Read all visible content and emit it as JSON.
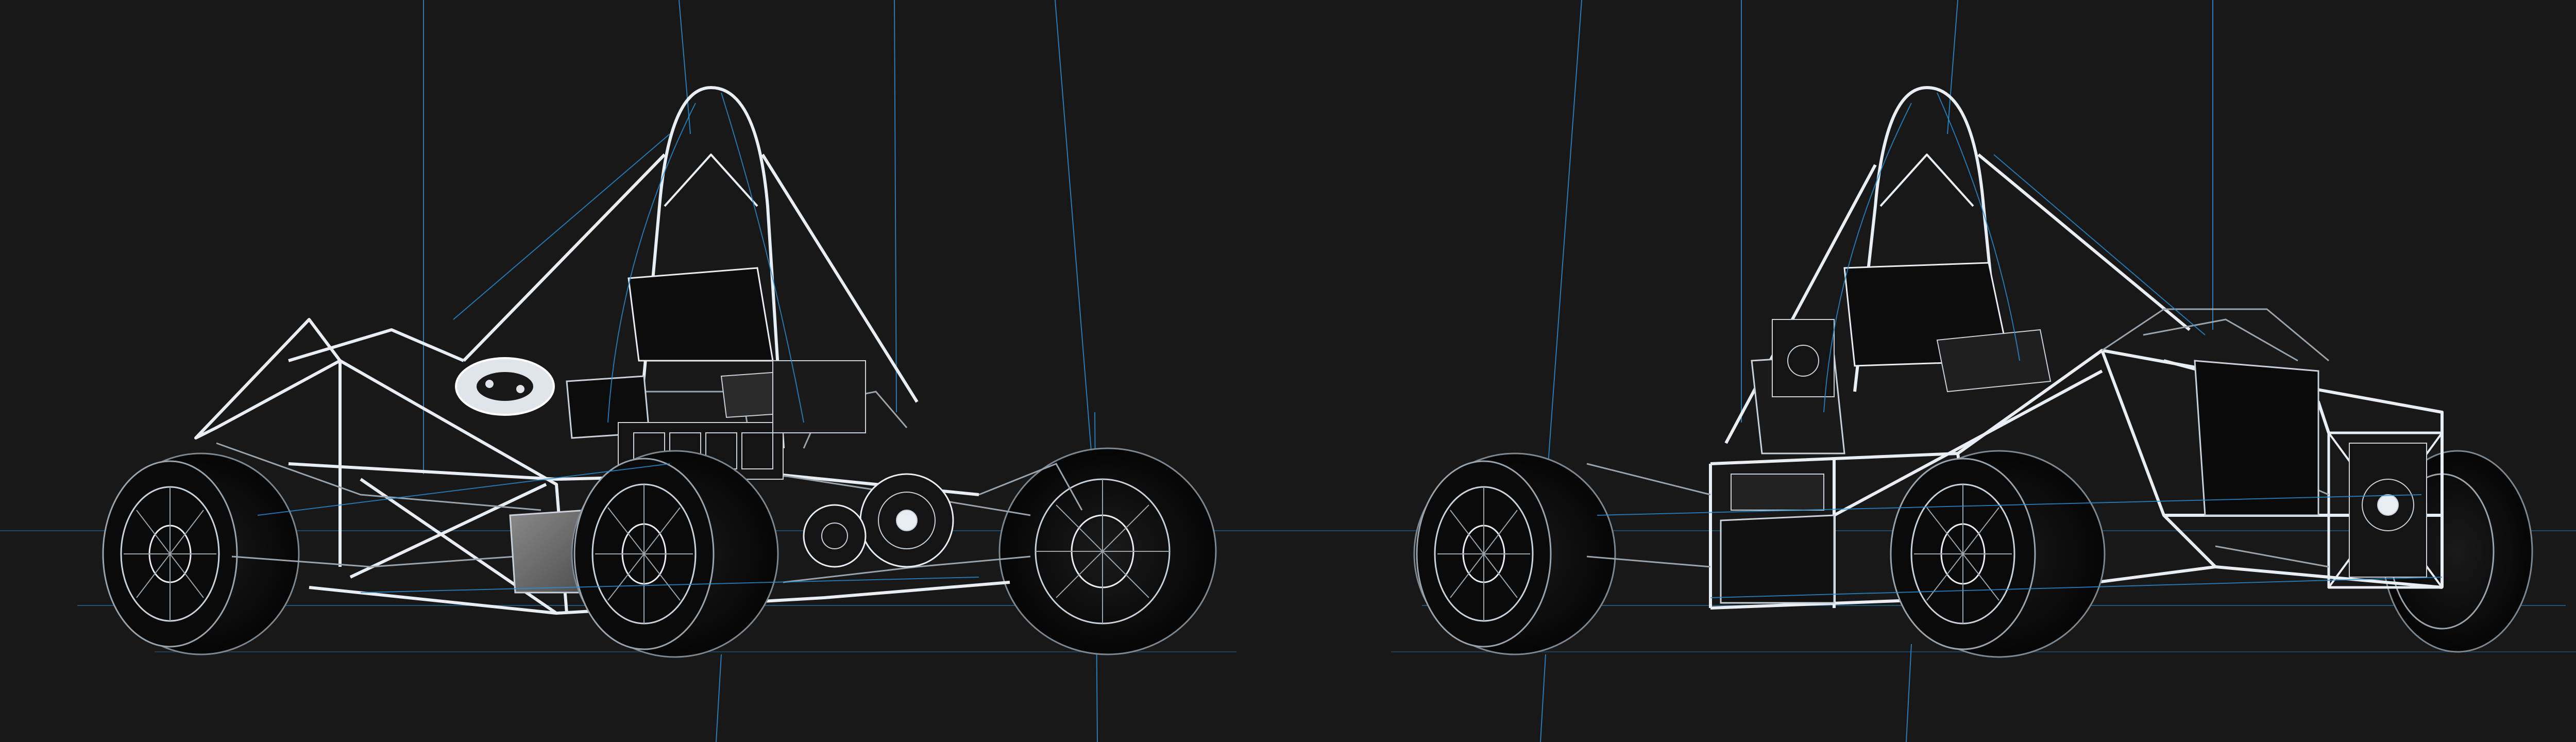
{
  "scene": {
    "background": "#181818",
    "colors": {
      "frame_white": "#e8eef3",
      "frame_gray": "#9aa4ad",
      "guide_blue": "#2b8fd6",
      "guide_blue_dim": "#1f5f8e",
      "tire_dark": "#0b0b0b",
      "panel_dark": "#0d0d0d",
      "panel_gray": "#6f6f6f"
    },
    "views": [
      {
        "id": "left-view",
        "depicts": "formula-student-car-front-three-quarter-wireframe"
      },
      {
        "id": "right-view",
        "depicts": "formula-student-car-rear-three-quarter-wireframe"
      }
    ]
  }
}
